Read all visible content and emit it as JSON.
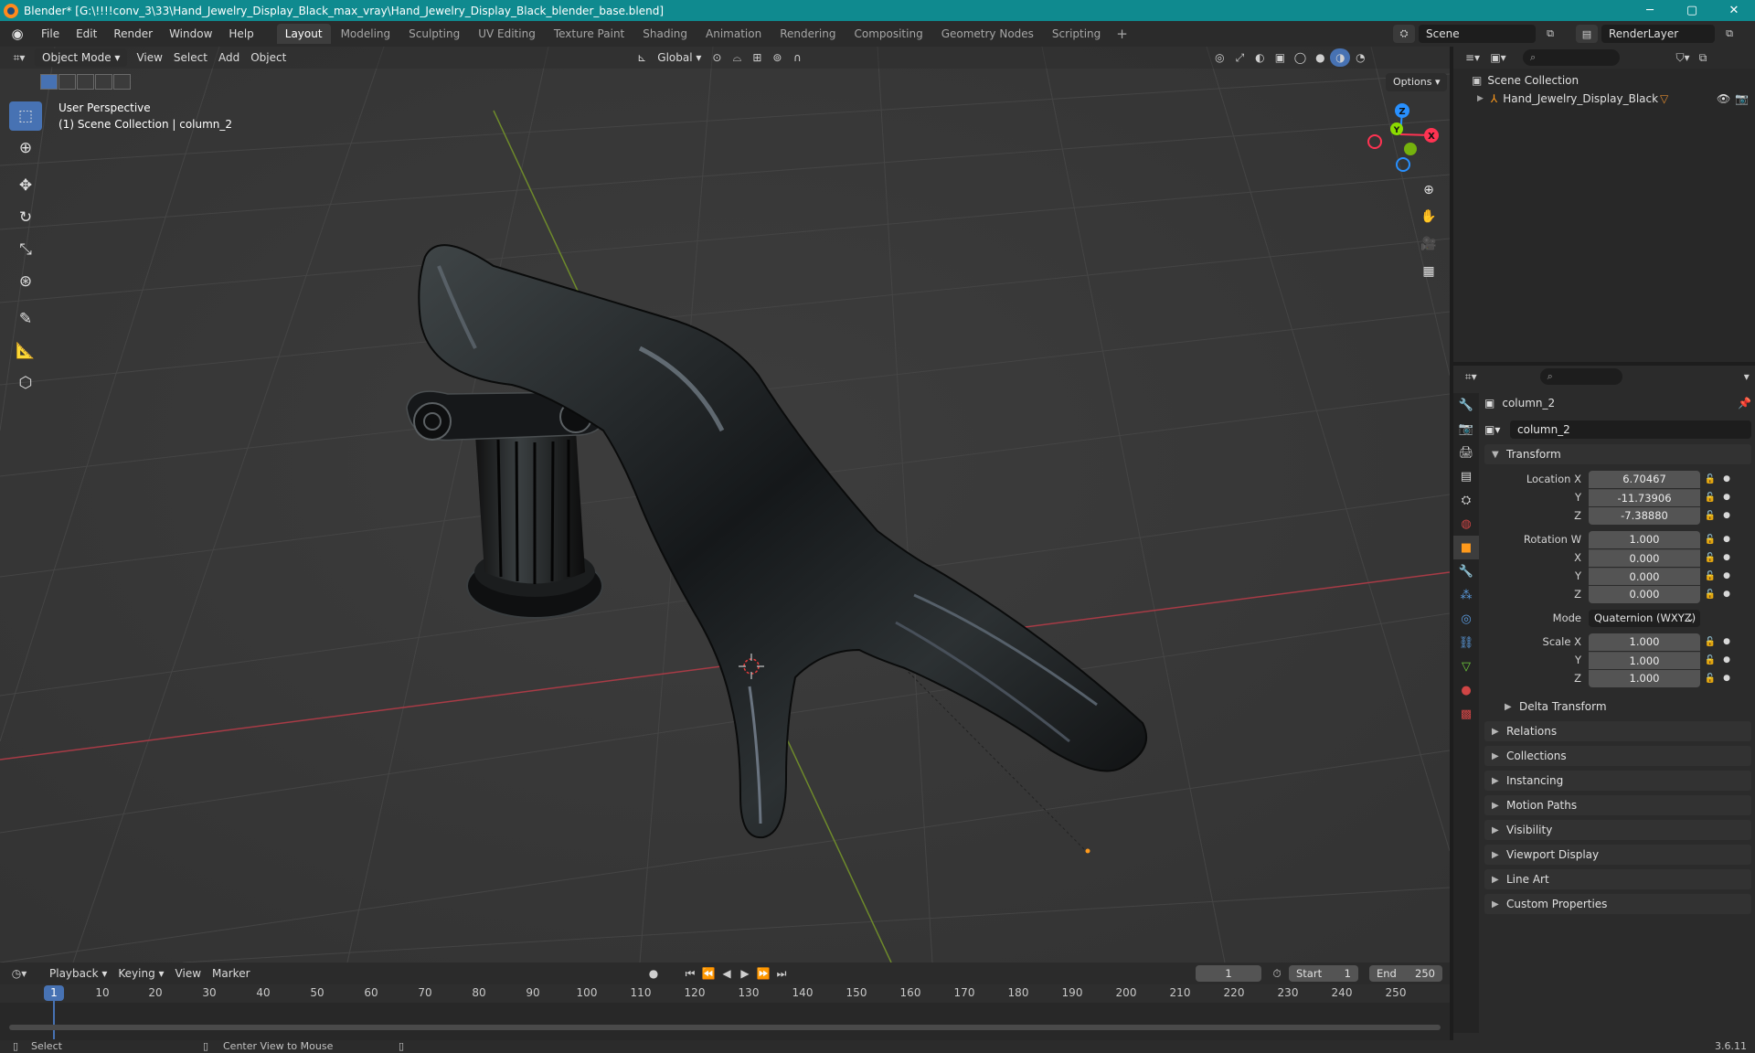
{
  "window": {
    "title": "Blender* [G:\\!!!!conv_3\\33\\Hand_Jewelry_Display_Black_max_vray\\Hand_Jewelry_Display_Black_blender_base.blend]",
    "minimize": "─",
    "maximize": "▢",
    "close": "✕"
  },
  "menu": {
    "items": [
      "File",
      "Edit",
      "Render",
      "Window",
      "Help"
    ]
  },
  "workspaces": {
    "tabs": [
      "Layout",
      "Modeling",
      "Sculpting",
      "UV Editing",
      "Texture Paint",
      "Shading",
      "Animation",
      "Rendering",
      "Compositing",
      "Geometry Nodes",
      "Scripting"
    ],
    "active": "Layout",
    "add": "+"
  },
  "scene": {
    "name": "Scene",
    "render_layer": "RenderLayer"
  },
  "viewport": {
    "mode": "Object Mode",
    "menus": [
      "View",
      "Select",
      "Add",
      "Object"
    ],
    "transform_orientation": "Global",
    "options": "Options",
    "info_line1": "User Perspective",
    "info_line2": "(1) Scene Collection | column_2",
    "gizmo": {
      "z": "Z",
      "x": "X",
      "y": "Y"
    }
  },
  "outliner": {
    "root": "Scene Collection",
    "items": [
      {
        "name": "Hand_Jewelry_Display_Black"
      }
    ]
  },
  "properties": {
    "object_name": "column_2",
    "data_name": "column_2",
    "transform": {
      "header": "Transform",
      "location_label": "Location X",
      "location": [
        "6.70467",
        "-11.73906",
        "-7.38880"
      ],
      "rotation_label": "Rotation W",
      "rotation": [
        "1.000",
        "0.000",
        "0.000",
        "0.000"
      ],
      "mode_label": "Mode",
      "mode": "Quaternion (WXYZ)",
      "scale_label": "Scale X",
      "scale": [
        "1.000",
        "1.000",
        "1.000"
      ],
      "axis_y": "Y",
      "axis_z": "Z",
      "axis_x": "X"
    },
    "delta_transform": "Delta Transform",
    "panels": [
      "Relations",
      "Collections",
      "Instancing",
      "Motion Paths",
      "Visibility",
      "Viewport Display",
      "Line Art",
      "Custom Properties"
    ]
  },
  "timeline": {
    "menus": [
      "Playback",
      "Keying",
      "View",
      "Marker"
    ],
    "current_frame": "1",
    "start_label": "Start",
    "start": "1",
    "end_label": "End",
    "end": "250",
    "ruler": [
      "1",
      "10",
      "20",
      "30",
      "40",
      "50",
      "60",
      "70",
      "80",
      "90",
      "100",
      "110",
      "120",
      "130",
      "140",
      "150",
      "160",
      "170",
      "180",
      "190",
      "200",
      "210",
      "220",
      "230",
      "240",
      "250"
    ]
  },
  "status": {
    "select": "Select",
    "center_view": "Center View to Mouse",
    "version": "3.6.11"
  },
  "colors": {
    "accent": "#4772b3",
    "title_bar": "#0f8a8f",
    "axis_x": "#ff3352",
    "axis_y": "#8bdc00",
    "axis_z": "#2890ff"
  }
}
